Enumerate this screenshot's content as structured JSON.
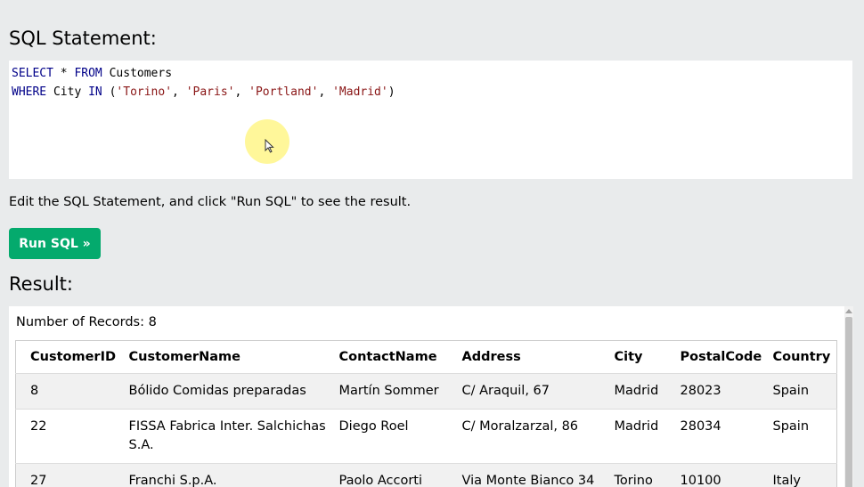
{
  "sql_heading": "SQL Statement:",
  "editor": {
    "line1": [
      {
        "t": "SELECT",
        "k": "kw"
      },
      {
        "t": " * ",
        "k": "plain"
      },
      {
        "t": "FROM",
        "k": "kw"
      },
      {
        "t": " Customers",
        "k": "plain"
      }
    ],
    "line2": [
      {
        "t": "WHERE",
        "k": "kw"
      },
      {
        "t": " City ",
        "k": "plain"
      },
      {
        "t": "IN",
        "k": "kw"
      },
      {
        "t": " (",
        "k": "plain"
      },
      {
        "t": "'Torino'",
        "k": "str"
      },
      {
        "t": ", ",
        "k": "plain"
      },
      {
        "t": "'Paris'",
        "k": "str"
      },
      {
        "t": ", ",
        "k": "plain"
      },
      {
        "t": "'Portland'",
        "k": "str"
      },
      {
        "t": ", ",
        "k": "plain"
      },
      {
        "t": "'Madrid'",
        "k": "str"
      },
      {
        "t": ")",
        "k": "plain"
      }
    ]
  },
  "hint": "Edit the SQL Statement, and click \"Run SQL\" to see the result.",
  "run_button": "Run SQL »",
  "result_heading": "Result:",
  "records_label": "Number of Records: 8",
  "table": {
    "columns": [
      "CustomerID",
      "CustomerName",
      "ContactName",
      "Address",
      "City",
      "PostalCode",
      "Country"
    ],
    "rows": [
      [
        "8",
        "Bólido Comidas preparadas",
        "Martín Sommer",
        "C/ Araquil, 67",
        "Madrid",
        "28023",
        "Spain"
      ],
      [
        "22",
        "FISSA Fabrica Inter. Salchichas S.A.",
        "Diego Roel",
        "C/ Moralzarzal, 86",
        "Madrid",
        "28034",
        "Spain"
      ],
      [
        "27",
        "Franchi S.p.A.",
        "Paolo Accorti",
        "Via Monte Bianco 34",
        "Torino",
        "10100",
        "Italy"
      ]
    ]
  },
  "colors": {
    "background": "#e9ebec",
    "button": "#04aa6d",
    "keyword": "#000088",
    "string": "#8a1616"
  }
}
